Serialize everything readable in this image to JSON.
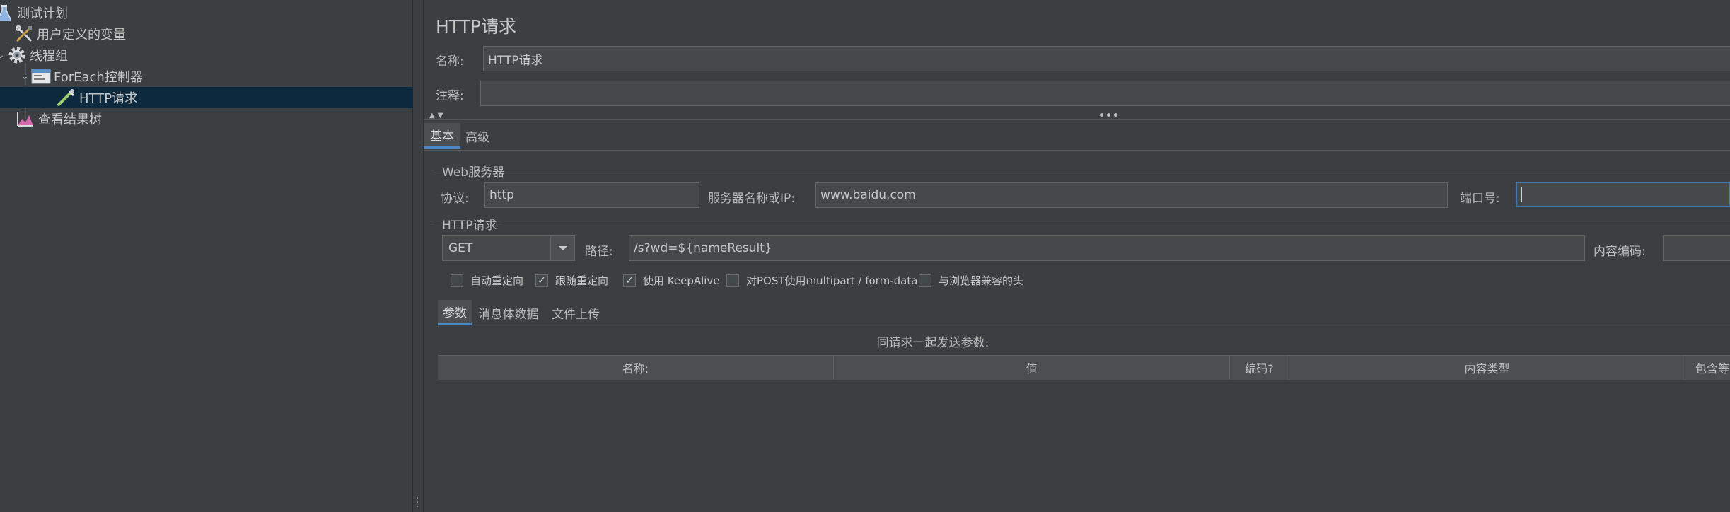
{
  "tree": {
    "items": [
      {
        "label": "测试计划",
        "icon": "flask-icon",
        "expanded": true
      },
      {
        "label": "用户定义的变量",
        "icon": "tools-icon"
      },
      {
        "label": "线程组",
        "icon": "gear-icon",
        "expanded": true
      },
      {
        "label": "ForEach控制器",
        "icon": "window-icon",
        "expanded": true
      },
      {
        "label": "HTTP请求",
        "icon": "pipette-icon",
        "selected": true
      },
      {
        "label": "查看结果树",
        "icon": "chart-icon"
      }
    ]
  },
  "panel": {
    "title": "HTTP请求",
    "name_label": "名称:",
    "name_value": "HTTP请求",
    "comment_label": "注释:",
    "comment_value": "",
    "tabs": [
      "基本",
      "高级"
    ],
    "active_tab": "基本"
  },
  "web_server": {
    "group_title": "Web服务器",
    "protocol_label": "协议:",
    "protocol_value": "http",
    "server_label": "服务器名称或IP:",
    "server_value": "www.baidu.com",
    "port_label": "端口号:",
    "port_value": ""
  },
  "http_request": {
    "group_title": "HTTP请求",
    "method": "GET",
    "path_label": "路径:",
    "path_value": "/s?wd=${nameResult}",
    "encoding_label": "内容编码:",
    "encoding_value": ""
  },
  "options": [
    {
      "label": "自动重定向",
      "checked": false
    },
    {
      "label": "跟随重定向",
      "checked": true
    },
    {
      "label": "使用 KeepAlive",
      "checked": true
    },
    {
      "label": "对POST使用multipart / form-data",
      "checked": false
    },
    {
      "label": "与浏览器兼容的头",
      "checked": false
    }
  ],
  "sub_tabs": [
    "参数",
    "消息体数据",
    "文件上传"
  ],
  "active_sub_tab": "参数",
  "params": {
    "caption": "同请求一起发送参数:",
    "columns": [
      "名称:",
      "值",
      "编码?",
      "内容类型",
      "包含等"
    ]
  },
  "colors": {
    "background": "#3c3f41",
    "selection": "#0d293e",
    "accent": "#4a88c7",
    "field_bg": "#45494a"
  }
}
